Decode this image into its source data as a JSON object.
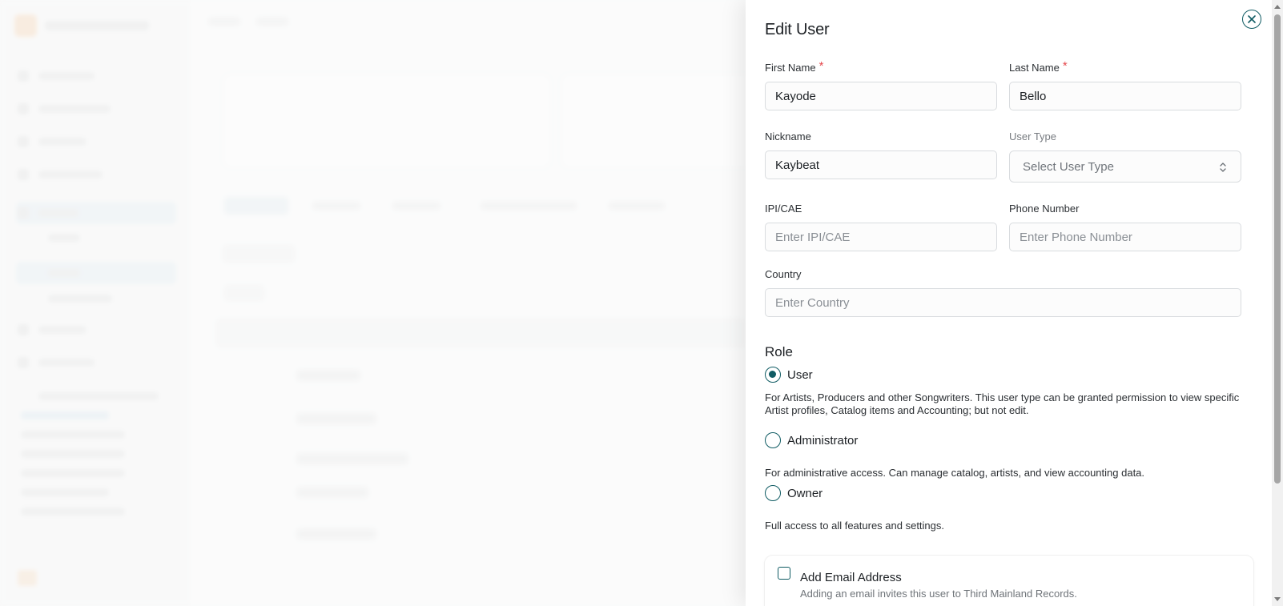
{
  "drawer": {
    "title": "Edit User",
    "fields": {
      "first_name": {
        "label": "First Name",
        "value": "Kayode"
      },
      "last_name": {
        "label": "Last Name",
        "value": "Bello"
      },
      "nickname": {
        "label": "Nickname",
        "value": "Kaybeat"
      },
      "user_type": {
        "label": "User Type",
        "placeholder": "Select User Type"
      },
      "ipi_cae": {
        "label": "IPI/CAE",
        "placeholder": "Enter IPI/CAE"
      },
      "phone": {
        "label": "Phone Number",
        "placeholder": "Enter Phone Number"
      },
      "country": {
        "label": "Country",
        "placeholder": "Enter Country"
      }
    },
    "required_marker": "*",
    "role": {
      "title": "Role",
      "selected": "User",
      "options": [
        {
          "label": "User",
          "description": "For Artists, Producers and other Songwriters. This user type can be granted permission to view specific Artist profiles, Catalog items and Accounting; but not edit."
        },
        {
          "label": "Administrator",
          "description": "For administrative access. Can manage catalog, artists, and view accounting data."
        },
        {
          "label": "Owner",
          "description": "Full access to all features and settings."
        }
      ]
    },
    "email": {
      "title": "Add Email Address",
      "description": "Adding an email invites this user to Third Mainland Records."
    }
  },
  "colors": {
    "accent": "#0f5b63",
    "required": "#e5484d"
  },
  "icons": {
    "close": "close-icon",
    "select_chevron": "chevron-up-down-icon"
  }
}
